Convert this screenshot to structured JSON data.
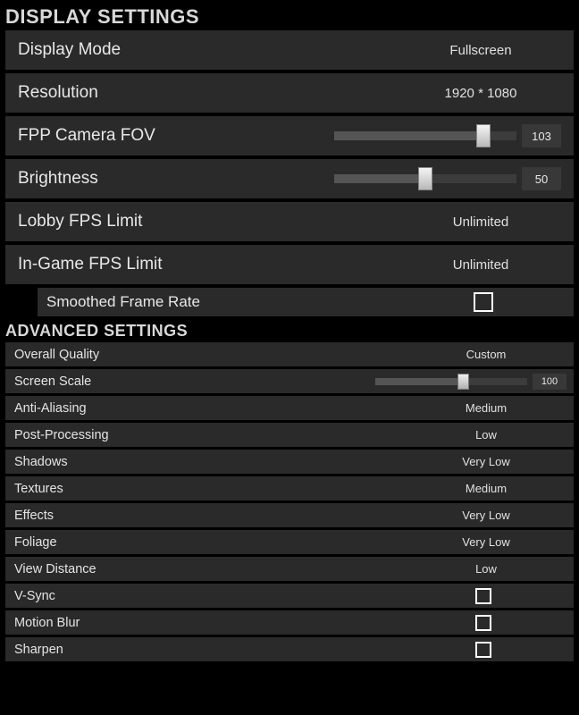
{
  "display": {
    "header": "DISPLAY SETTINGS",
    "mode": {
      "label": "Display Mode",
      "value": "Fullscreen"
    },
    "resolution": {
      "label": "Resolution",
      "value": "1920 * 1080"
    },
    "fov": {
      "label": "FPP Camera FOV",
      "value": "103",
      "pct": 82
    },
    "brightness": {
      "label": "Brightness",
      "value": "50",
      "pct": 50
    },
    "lobby_fps": {
      "label": "Lobby FPS Limit",
      "value": "Unlimited"
    },
    "ingame_fps": {
      "label": "In-Game FPS Limit",
      "value": "Unlimited"
    },
    "smoothed": {
      "label": "Smoothed Frame Rate",
      "checked": false
    }
  },
  "advanced": {
    "header": "ADVANCED SETTINGS",
    "overall": {
      "label": "Overall Quality",
      "value": "Custom"
    },
    "scale": {
      "label": "Screen Scale",
      "value": "100",
      "pct": 59
    },
    "aa": {
      "label": "Anti-Aliasing",
      "value": "Medium"
    },
    "post": {
      "label": "Post-Processing",
      "value": "Low"
    },
    "shadows": {
      "label": "Shadows",
      "value": "Very Low"
    },
    "textures": {
      "label": "Textures",
      "value": "Medium"
    },
    "effects": {
      "label": "Effects",
      "value": "Very Low"
    },
    "foliage": {
      "label": "Foliage",
      "value": "Very Low"
    },
    "viewdist": {
      "label": "View Distance",
      "value": "Low"
    },
    "vsync": {
      "label": "V-Sync",
      "checked": false
    },
    "mblur": {
      "label": "Motion Blur",
      "checked": false
    },
    "sharpen": {
      "label": "Sharpen",
      "checked": false
    }
  }
}
